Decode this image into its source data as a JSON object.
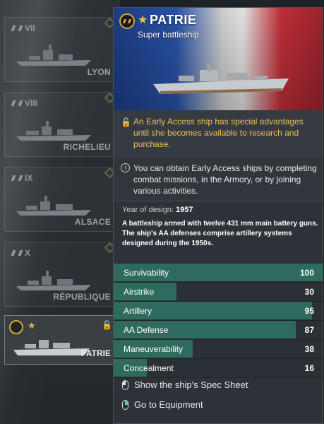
{
  "tree": {
    "items": [
      {
        "tier": "VII",
        "name": "LYON"
      },
      {
        "tier": "VIII",
        "name": "RICHELIEU"
      },
      {
        "tier": "IX",
        "name": "ALSACE"
      },
      {
        "tier": "X",
        "name": "RÉPUBLIQUE"
      }
    ],
    "selected": {
      "name": "PATRIE",
      "star": "★",
      "lock_icon": "lock-icon"
    }
  },
  "tooltip": {
    "star": "★",
    "title": "PATRIE",
    "subtitle": "Super battleship",
    "early_access_text": "An Early Access ship has special advantages until she becomes available to research and purchase.",
    "info_text": "You can obtain Early Access ships by completing combat missions, in the Armory, or by joining various activities.",
    "year_label": "Year of design:",
    "year_value": "1957",
    "description": "A battleship armed with twelve 431 mm main battery guns. The ship's AA defenses comprise artillery systems designed during the 1950s.",
    "stats": [
      {
        "label": "Survivability",
        "value": "100",
        "level": 100
      },
      {
        "label": "Airstrike",
        "value": "30",
        "level": 30
      },
      {
        "label": "Artillery",
        "value": "95",
        "level": 95
      },
      {
        "label": "AA Defense",
        "value": "87",
        "level": 87
      },
      {
        "label": "Maneuverability",
        "value": "38",
        "level": 38
      },
      {
        "label": "Concealment",
        "value": "16",
        "level": 16
      }
    ],
    "actions": {
      "spec_sheet": "Show the ship's Spec Sheet",
      "equipment": "Go to Equipment"
    }
  },
  "colors": {
    "accent_gold": "#e0b43c",
    "stat_fill": "#2e6b5e",
    "panel_bg": "#2c3238"
  }
}
